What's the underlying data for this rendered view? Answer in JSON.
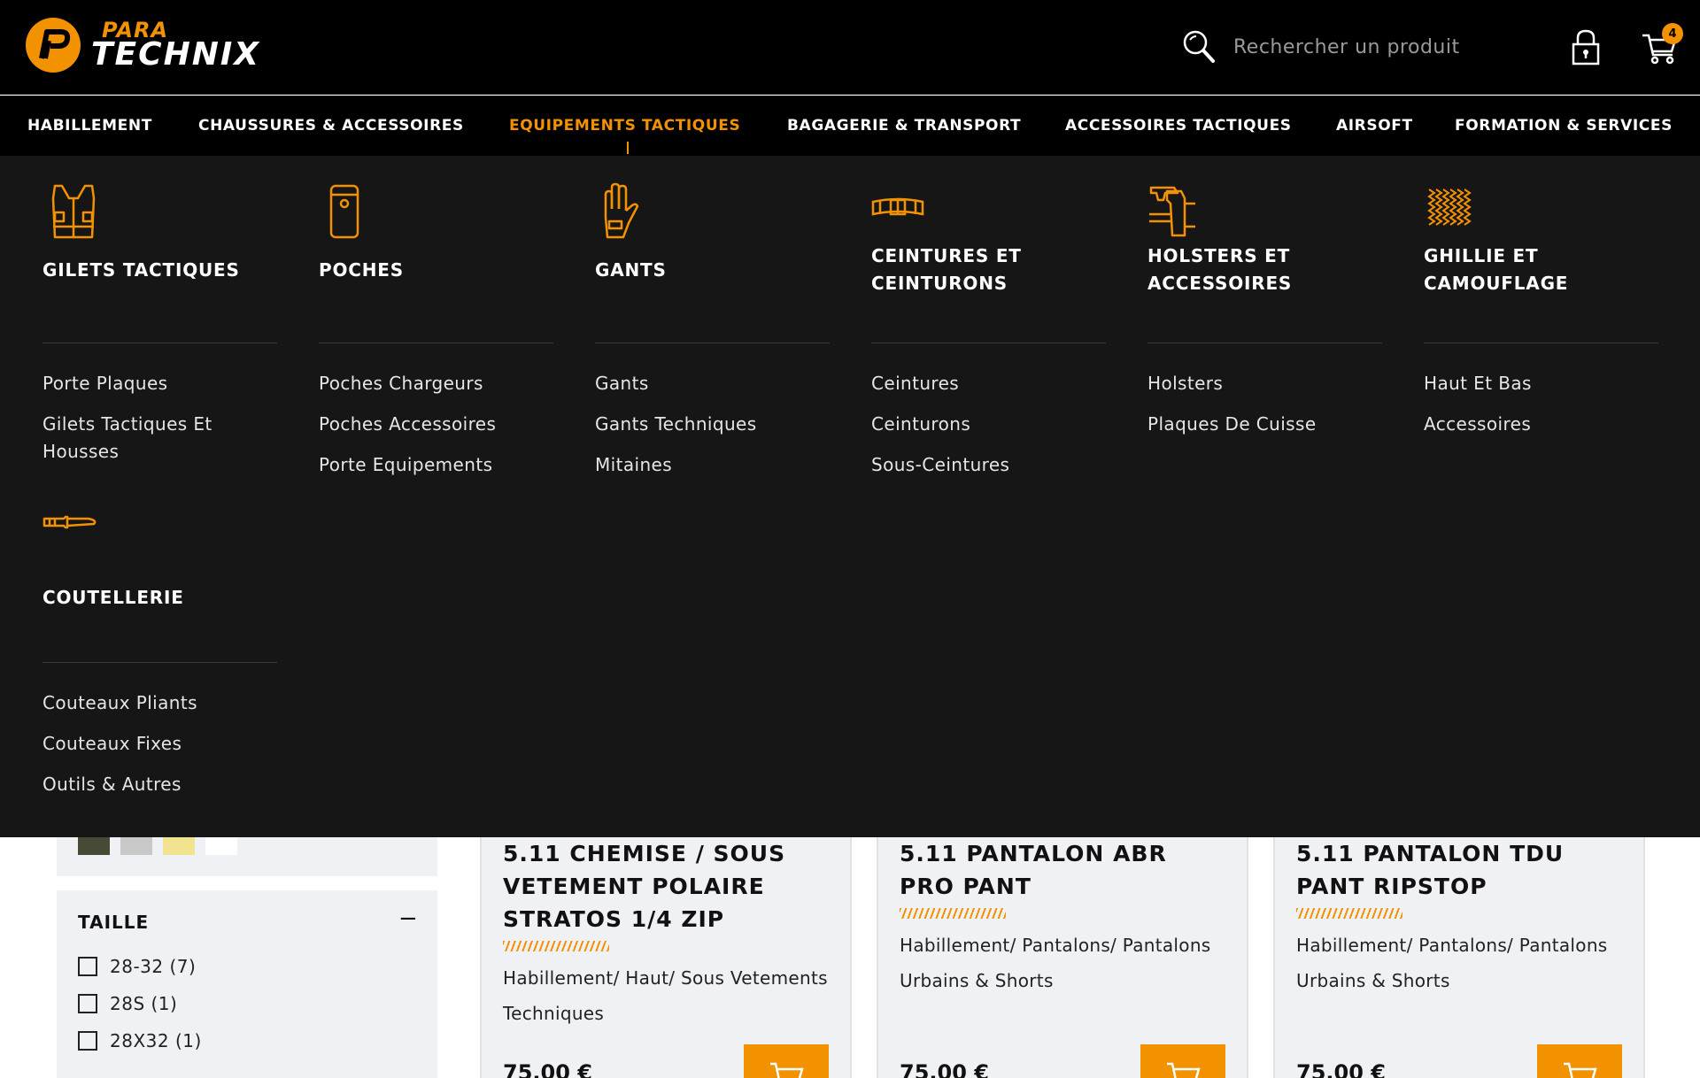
{
  "header": {
    "logo_top": "PARA",
    "logo_bottom": "TECHNIX",
    "search_placeholder": "Rechercher un produit",
    "cart_count": "4"
  },
  "nav": {
    "items": [
      {
        "label": "HABILLEMENT"
      },
      {
        "label": "CHAUSSURES & ACCESSOIRES"
      },
      {
        "label": "EQUIPEMENTS TACTIQUES"
      },
      {
        "label": "BAGAGERIE & TRANSPORT"
      },
      {
        "label": "ACCESSOIRES TACTIQUES"
      },
      {
        "label": "AIRSOFT"
      },
      {
        "label": "FORMATION & SERVICES"
      }
    ],
    "active": "EQUIPEMENTS TACTIQUES"
  },
  "mega_menu": {
    "categories": [
      {
        "title": "GILETS TACTIQUES",
        "icon": "vest-icon",
        "links": [
          "Porte Plaques",
          "Gilets Tactiques Et Housses"
        ]
      },
      {
        "title": "POCHES",
        "icon": "pouch-icon",
        "links": [
          "Poches Chargeurs",
          "Poches Accessoires",
          "Porte Equipements"
        ]
      },
      {
        "title": "GANTS",
        "icon": "glove-icon",
        "links": [
          "Gants",
          "Gants Techniques",
          "Mitaines"
        ]
      },
      {
        "title": "CEINTURES ET CEINTURONS",
        "icon": "belt-icon",
        "links": [
          "Ceintures",
          "Ceinturons",
          "Sous-Ceintures"
        ]
      },
      {
        "title": "HOLSTERS ET ACCESSOIRES",
        "icon": "holster-icon",
        "links": [
          "Holsters",
          "Plaques De Cuisse"
        ]
      },
      {
        "title": "GHILLIE ET CAMOUFLAGE",
        "icon": "camouflage-net-icon",
        "links": [
          "Haut Et Bas",
          "Accessoires"
        ]
      },
      {
        "title": "COUTELLERIE",
        "icon": "knife-icon",
        "links": [
          "Couteaux Pliants",
          "Couteaux Fixes",
          "Outils & Autres"
        ]
      }
    ]
  },
  "filters": {
    "color_swatches": [
      "#474b36",
      "#c8c8c8",
      "#f1e38f",
      "#ffffff"
    ],
    "taille_title": "TAILLE",
    "taille_options": [
      "28-32 (7)",
      "28S (1)",
      "28X32 (1)"
    ]
  },
  "products": [
    {
      "title": "5.11 CHEMISE / SOUS VETEMENT POLAIRE STRATOS 1/4 ZIP",
      "path": "Habillement/ Haut/ Sous Vetements Techniques",
      "price": "75,00 €"
    },
    {
      "title": "5.11 PANTALON ABR PRO PANT",
      "path": "Habillement/ Pantalons/ Pantalons Urbains & Shorts",
      "price": "75,00 €"
    },
    {
      "title": "5.11 PANTALON TDU PANT RIPSTOP",
      "path": "Habillement/ Pantalons/ Pantalons Urbains & Shorts",
      "price": "75,00 €"
    }
  ],
  "colors": {
    "accent": "#f39200",
    "header_bg": "#000000",
    "menu_bg": "#161616"
  }
}
